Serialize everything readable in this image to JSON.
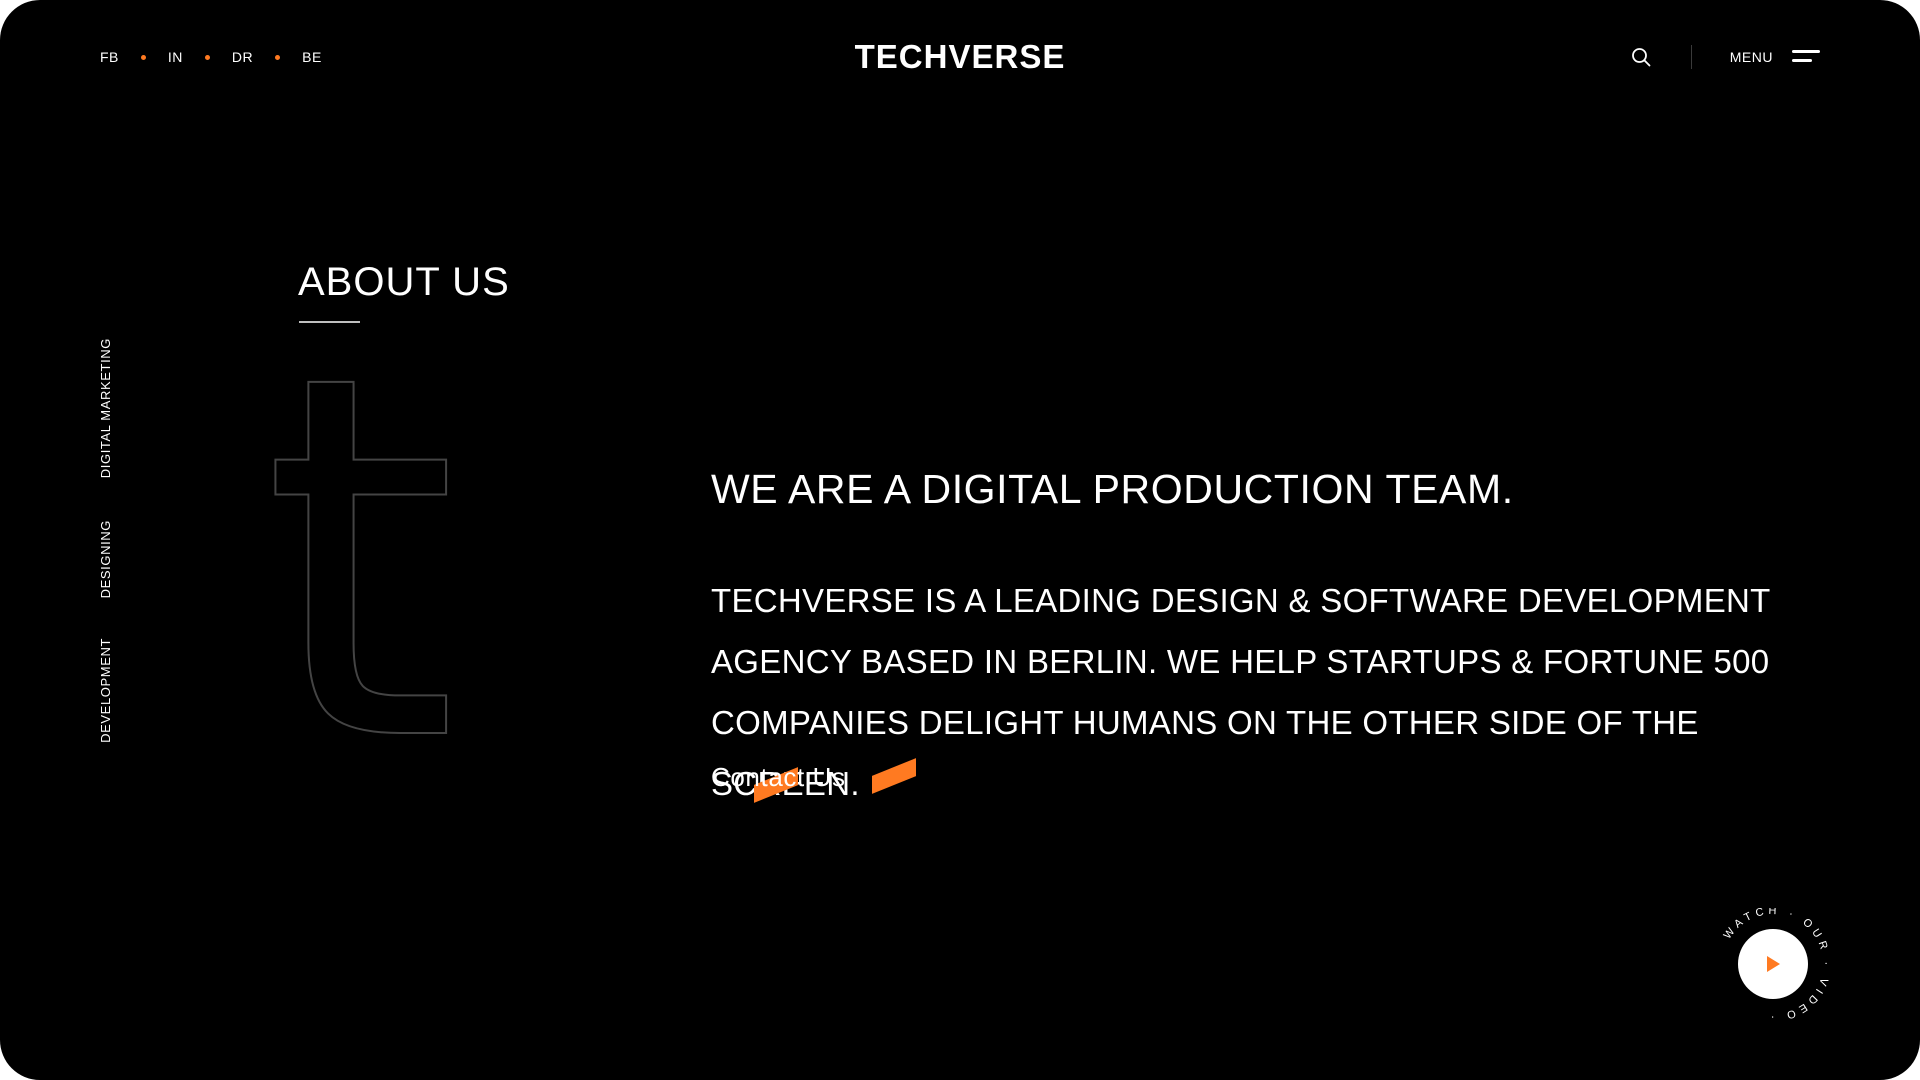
{
  "header": {
    "social_links": [
      {
        "label": "FB"
      },
      {
        "label": "IN"
      },
      {
        "label": "DR"
      },
      {
        "label": "BE"
      }
    ],
    "brand": "TECHVERSE",
    "search_icon": "search-icon",
    "menu_label": "MENU",
    "menu_icon": "hamburger-icon"
  },
  "side_nav": {
    "items": [
      {
        "label": "DIGITAL MARKETING"
      },
      {
        "label": "DESIGNING"
      },
      {
        "label": "DEVELOPMENT"
      }
    ]
  },
  "about": {
    "title": "ABOUT US",
    "decorative_letter": "t",
    "headline": "WE ARE A DIGITAL PRODUCTION TEAM.",
    "body": "TECHVERSE IS A LEADING DESIGN & SOFTWARE DEVELOPMENT AGENCY BASED IN BERLIN. WE HELP STARTUPS & FORTUNE 500 COMPANIES DELIGHT HUMANS ON THE OTHER SIDE OF THE SCREEN.",
    "contact_label": "Contact Us"
  },
  "video": {
    "ring_text": "WATCH · OUR · VIDEO ·",
    "play_icon": "play-icon"
  },
  "colors": {
    "background": "#000000",
    "text": "#ffffff",
    "accent": "#ff7a21",
    "outline": "#444444"
  }
}
